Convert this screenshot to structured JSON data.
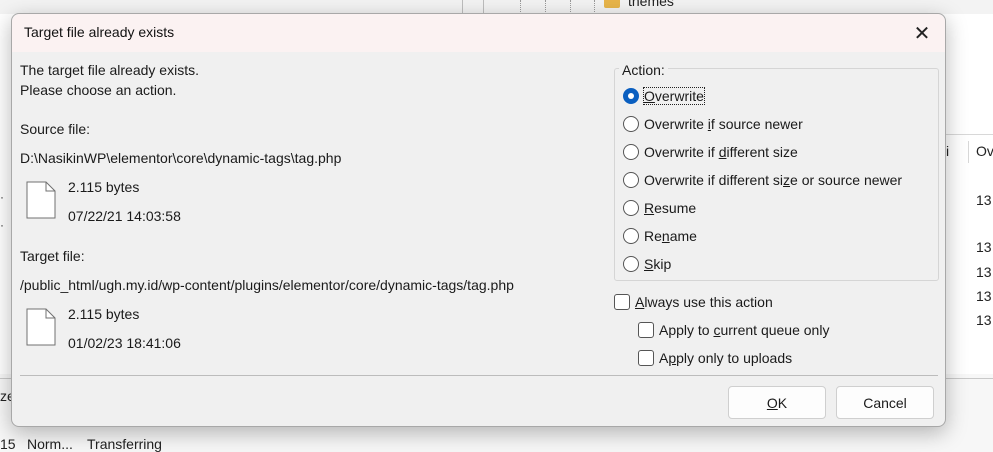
{
  "background": {
    "folder_name": "themes",
    "right_header_a": "i",
    "right_header_b": "Ov",
    "right_cells": [
      "13",
      "13",
      "13",
      "13",
      "13"
    ],
    "left_bits": [
      "·",
      "·"
    ],
    "bottom_ze": "ze",
    "status": {
      "col1": "15",
      "col2": "Norm...",
      "col3": "Transferring"
    }
  },
  "dialog": {
    "title": "Target file already exists",
    "close_glyph": "✕",
    "message_line1": "The target file already exists.",
    "message_line2": "Please choose an action.",
    "source": {
      "label": "Source file:",
      "path": "D:\\NasikinWP\\elementor\\core\\dynamic-tags\\tag.php",
      "size": "2.115 bytes",
      "date": "07/22/21 14:03:58"
    },
    "target": {
      "label": "Target file:",
      "path": "/public_html/ugh.my.id/wp-content/plugins/elementor/core/dynamic-tags/tag.php",
      "size": "2.115 bytes",
      "date": "01/02/23 18:41:06"
    },
    "action": {
      "legend": "Action:",
      "selected": "overwrite",
      "options": {
        "overwrite": {
          "pre": "",
          "u": "O",
          "post": "verwrite"
        },
        "overwrite_newer": {
          "pre": "Overwrite ",
          "u": "i",
          "post": "f source newer"
        },
        "overwrite_size": {
          "pre": "Overwrite if ",
          "u": "d",
          "post": "ifferent size"
        },
        "overwrite_size_newer": {
          "pre": "Overwrite if different si",
          "u": "z",
          "post": "e or source newer"
        },
        "resume": {
          "pre": "",
          "u": "R",
          "post": "esume"
        },
        "rename": {
          "pre": "Re",
          "u": "n",
          "post": "ame"
        },
        "skip": {
          "pre": "",
          "u": "S",
          "post": "kip"
        }
      }
    },
    "always": {
      "pre": "",
      "u": "A",
      "post": "lways use this action"
    },
    "apply_queue": {
      "pre": "Apply to ",
      "u": "c",
      "post": "urrent queue only"
    },
    "apply_uploads": {
      "pre": "A",
      "u": "p",
      "post": "ply only to uploads"
    },
    "ok": {
      "pre": "",
      "u": "O",
      "post": "K"
    },
    "cancel": "Cancel"
  },
  "colors": {
    "accent": "#0a5fc0",
    "titlebar": "#fbf2f2",
    "dialog_bg": "#f0f0f0"
  }
}
